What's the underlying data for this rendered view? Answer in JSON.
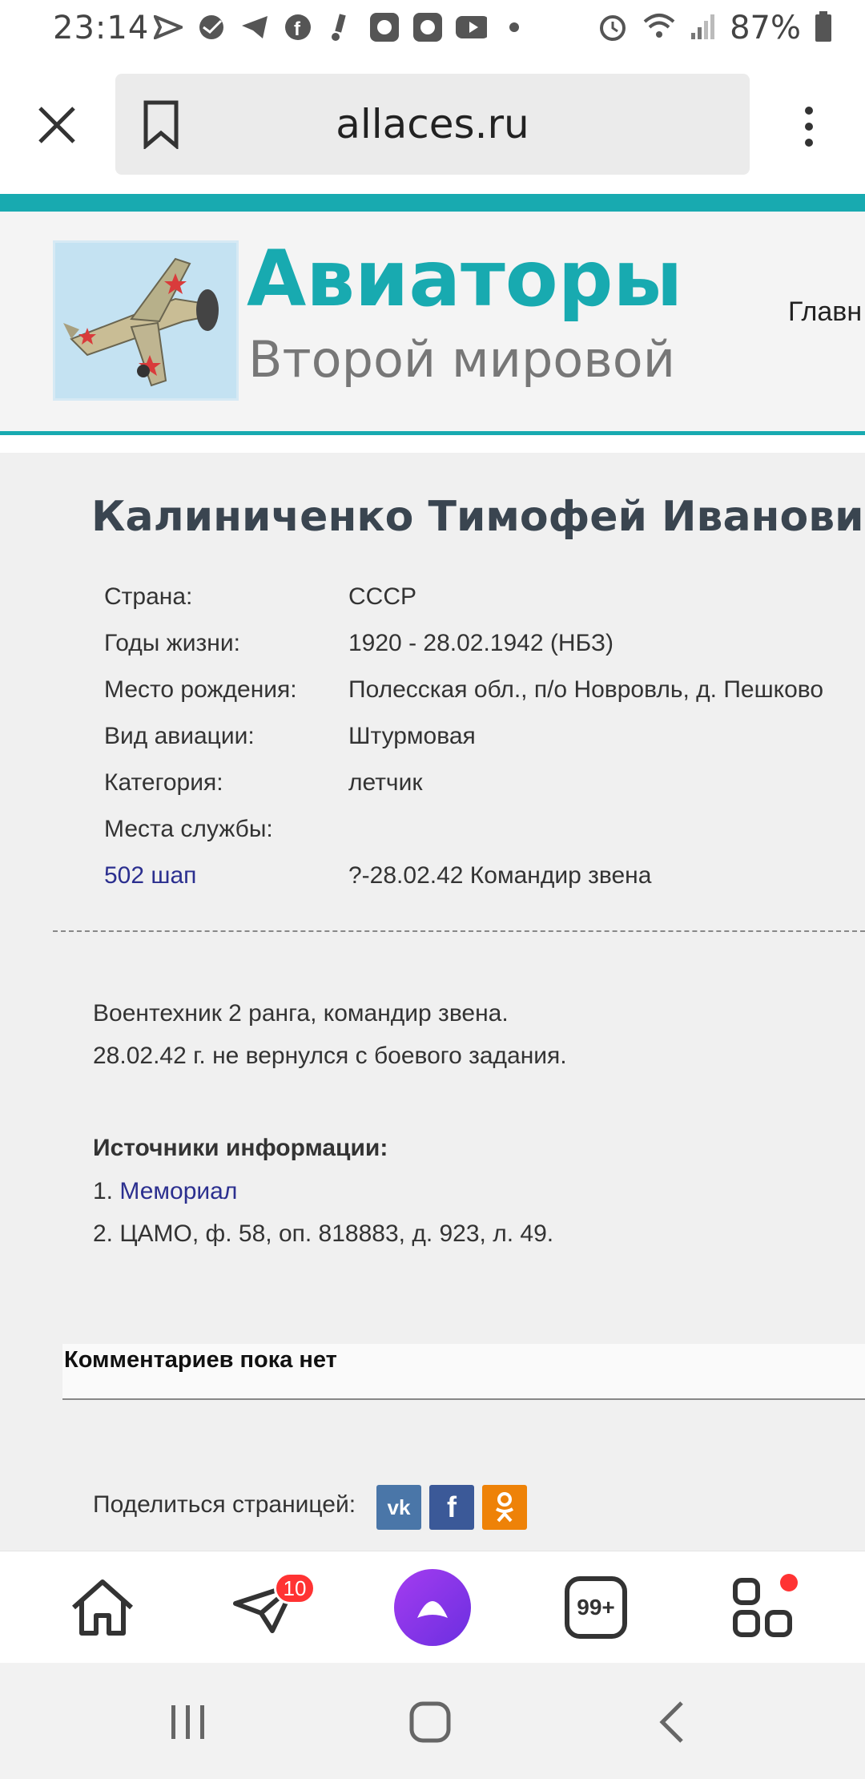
{
  "status_bar": {
    "time": "23:14",
    "battery": "87%",
    "icons": [
      "send-icon",
      "sber-icon",
      "telegram-icon",
      "facebook-icon",
      "notification-icon",
      "app-icon",
      "app-icon",
      "youtube-icon",
      "dot-icon",
      "alarm-icon",
      "wifi-icon",
      "signal-icon",
      "battery-icon"
    ]
  },
  "browser": {
    "url": "allaces.ru"
  },
  "site": {
    "title": "Авиаторы",
    "subtitle": "Второй мировой",
    "nav_main": "Главн"
  },
  "person": {
    "name": "Калиниченко Тимофей Иванович",
    "fields": [
      {
        "label": "Страна:",
        "value": "СССР"
      },
      {
        "label": "Годы жизни:",
        "value": "1920 - 28.02.1942 (НБЗ)"
      },
      {
        "label": "Место рождения:",
        "value": "Полесская обл., п/о Новровль, д. Пешково"
      },
      {
        "label": "Вид авиации:",
        "value": "Штурмовая"
      },
      {
        "label": "Категория:",
        "value": "летчик"
      },
      {
        "label": "Места службы:",
        "value": ""
      }
    ],
    "service": {
      "unit": "502 шап",
      "period": "?-28.02.42",
      "role": "Командир звена"
    }
  },
  "bio": {
    "line1": "Воентехник 2 ранга, командир звена.",
    "line2": "28.02.42 г. не вернулся с боевого задания."
  },
  "sources": {
    "heading": "Источники информации:",
    "item1_num": "1.",
    "item1_link": "Мемориал",
    "item2": "2. ЦАМО, ф. 58, оп. 818883, д. 923, л. 49."
  },
  "comments": {
    "empty_text": "Комментариев пока нет"
  },
  "share": {
    "label": "Поделиться страницей:",
    "vk": "vk",
    "fb": "f",
    "ok": "ok"
  },
  "bottom_nav": {
    "badge": "10",
    "tabs_counter": "99+"
  },
  "colors": {
    "accent": "#18aab0",
    "link": "#2b2f8f",
    "alice": "#8a2be2"
  }
}
